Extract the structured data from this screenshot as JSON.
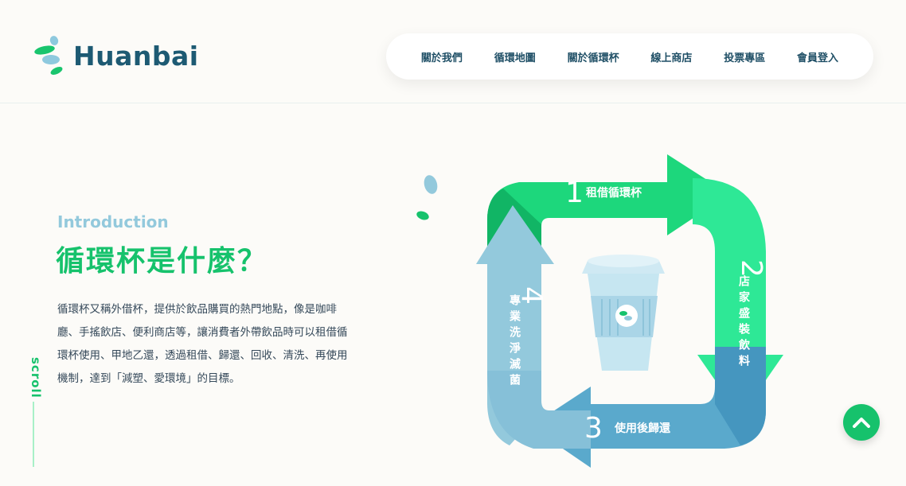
{
  "header": {
    "brand": "Huanbai",
    "nav": [
      "關於我們",
      "循環地圖",
      "關於循環杯",
      "線上商店",
      "投票專區",
      "會員登入"
    ]
  },
  "hero": {
    "label": "Introduction",
    "title": "循環杯是什麼？",
    "description": "循環杯又稱外借杯，提供於飲品購買的熱門地點，像是咖啡廳、手搖飲店、便利商店等，讓消費者外帶飲品時可以租借循環杯使用、甲地乙還，透過租借、歸還、回收、清洗、再使用機制，達到「減塑、愛環境」的目標。",
    "scroll_label": "scroll"
  },
  "cycle": {
    "steps": [
      {
        "num": "1",
        "label": "租借循環杯"
      },
      {
        "num": "2",
        "label": "店家盛裝飲料"
      },
      {
        "num": "3",
        "label": "使用後歸還"
      },
      {
        "num": "4",
        "label": "專業洗淨滅菌"
      }
    ]
  },
  "colors": {
    "green": "#16c26c",
    "light_blue": "#93c9dc",
    "navy": "#1d5a73"
  },
  "icons": {
    "back_to_top": "chevron-up-icon"
  }
}
